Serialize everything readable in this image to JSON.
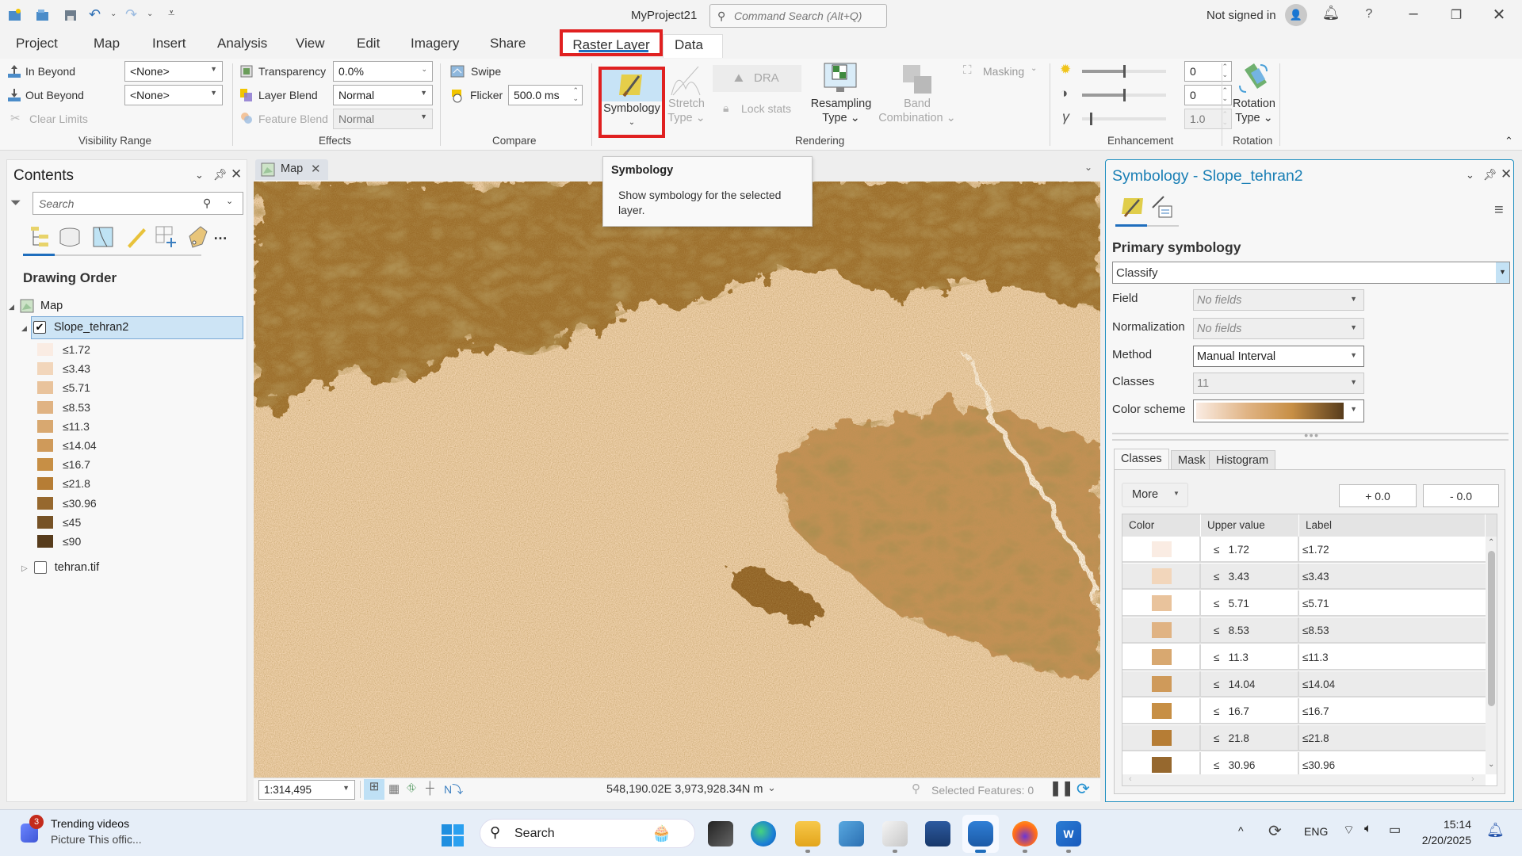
{
  "window": {
    "title": "MyProject21",
    "command_search_placeholder": "Command Search (Alt+Q)",
    "sign_in_status": "Not signed in",
    "help": "?"
  },
  "ribbon_tabs": [
    "Project",
    "Map",
    "Insert",
    "Analysis",
    "View",
    "Edit",
    "Imagery",
    "Share",
    "Raster Layer",
    "Data"
  ],
  "active_tab": "Raster Layer",
  "ribbon": {
    "visibility_range": {
      "label": "Visibility Range",
      "in_beyond": "In Beyond",
      "out_beyond": "Out Beyond",
      "clear_limits": "Clear Limits",
      "in_value": "<None>",
      "out_value": "<None>"
    },
    "effects": {
      "label": "Effects",
      "transparency": "Transparency",
      "transparency_value": "0.0%",
      "layer_blend": "Layer Blend",
      "layer_blend_value": "Normal",
      "feature_blend": "Feature Blend",
      "feature_blend_value": "Normal"
    },
    "compare": {
      "label": "Compare",
      "swipe": "Swipe",
      "flicker": "Flicker",
      "flicker_value": "500.0  ms"
    },
    "rendering": {
      "label": "Rendering",
      "symbology": "Symbology",
      "stretch_type_1": "Stretch",
      "stretch_type_2": "Type",
      "dra": "DRA",
      "lock_stats": "Lock stats",
      "resampling_1": "Resampling",
      "resampling_2": "Type",
      "band_1": "Band",
      "band_2": "Combination",
      "masking": "Masking"
    },
    "enhancement": {
      "label": "Enhancement",
      "brightness": "0",
      "contrast": "0",
      "gamma": "1.0",
      "brightness_level_pct": 50,
      "contrast_level_pct": 50,
      "gamma_level_pct": 10
    },
    "rotation": {
      "label": "Rotation",
      "btn_1": "Rotation",
      "btn_2": "Type"
    }
  },
  "tooltip": {
    "title": "Symbology",
    "body": "Show symbology for the selected layer."
  },
  "contents": {
    "title": "Contents",
    "search_placeholder": "Search",
    "section": "Drawing Order",
    "map_item": "Map",
    "layer": "Slope_tehran2",
    "layer_checked": true,
    "other_layer": "tehran.tif",
    "other_layer_checked": false,
    "legend": [
      {
        "label": "≤1.72",
        "color": "#faece3"
      },
      {
        "label": "≤3.43",
        "color": "#f2d6bb"
      },
      {
        "label": "≤5.71",
        "color": "#e9c39c"
      },
      {
        "label": "≤8.53",
        "color": "#e0b383"
      },
      {
        "label": "≤11.3",
        "color": "#d8a870"
      },
      {
        "label": "≤14.04",
        "color": "#cf9a5a"
      },
      {
        "label": "≤16.7",
        "color": "#c78f45"
      },
      {
        "label": "≤21.8",
        "color": "#b67d35"
      },
      {
        "label": "≤30.96",
        "color": "#96682e"
      },
      {
        "label": "≤45",
        "color": "#765226"
      },
      {
        "label": "≤90",
        "color": "#573c1c"
      }
    ]
  },
  "map_view": {
    "tab_label": "Map",
    "scale": "1:314,495",
    "coordinates": "548,190.02E 3,973,928.34N m",
    "selected_features": "Selected Features: 0"
  },
  "symbology": {
    "title": "Symbology - Slope_tehran2",
    "primary_label": "Primary symbology",
    "renderer": "Classify",
    "field_label": "Field",
    "field_value": "No fields",
    "normalization_label": "Normalization",
    "normalization_value": "No fields",
    "method_label": "Method",
    "method_value": "Manual Interval",
    "classes_label": "Classes",
    "classes_value": "11",
    "color_scheme_label": "Color scheme",
    "tabs": [
      "Classes",
      "Mask",
      "Histogram"
    ],
    "more_label": "More",
    "plus_value": "+ 0.0",
    "minus_value": "- 0.0",
    "columns": [
      "Color",
      "Upper value",
      "Label"
    ],
    "rows": [
      {
        "color": "#faece3",
        "upper": "≤   1.72",
        "label": "≤1.72"
      },
      {
        "color": "#f2d6bb",
        "upper": "≤   3.43",
        "label": "≤3.43"
      },
      {
        "color": "#e9c39c",
        "upper": "≤   5.71",
        "label": "≤5.71"
      },
      {
        "color": "#e0b383",
        "upper": "≤   8.53",
        "label": "≤8.53"
      },
      {
        "color": "#d8a870",
        "upper": "≤   11.3",
        "label": "≤11.3"
      },
      {
        "color": "#cf9a5a",
        "upper": "≤   14.04",
        "label": "≤14.04"
      },
      {
        "color": "#c78f45",
        "upper": "≤   16.7",
        "label": "≤16.7"
      },
      {
        "color": "#b67d35",
        "upper": "≤   21.8",
        "label": "≤21.8"
      },
      {
        "color": "#96682e",
        "upper": "≤   30.96",
        "label": "≤30.96"
      }
    ]
  },
  "taskbar": {
    "news_badge": "3",
    "news_title": "Trending videos",
    "news_sub": "Picture This offic...",
    "search_label": "Search",
    "language": "ENG",
    "time": "15:14",
    "date": "2/20/2025"
  },
  "colors": {
    "accent": "#1f6ebd",
    "highlight_box": "#e02020",
    "pane_title": "#1a7fb5"
  }
}
